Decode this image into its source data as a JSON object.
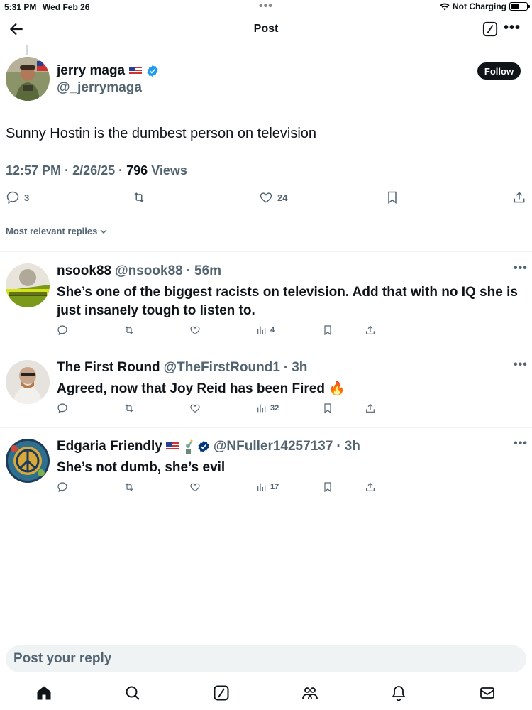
{
  "status": {
    "time": "5:31 PM",
    "date": "Wed Feb 26",
    "network": "Not Charging"
  },
  "header": {
    "title": "Post"
  },
  "post": {
    "author_name": "jerry maga",
    "author_handle": "@_jerrymaga",
    "follow_label": "Follow",
    "text": "Sunny Hostin is the dumbest person on television",
    "time": "12:57 PM",
    "date": "2/26/25",
    "views_count": "796",
    "views_label": "Views",
    "replies": "3",
    "likes": "24"
  },
  "sort_label": "Most relevant replies",
  "replies": [
    {
      "name": "nsook88",
      "handle": "@nsook88",
      "age": "56m",
      "text": "She’s one of the biggest racists on television. Add that with no IQ she is just insanely tough to listen to.",
      "views": "4"
    },
    {
      "name": "The First Round",
      "handle": "@TheFirstRound1",
      "age": "3h",
      "text": "Agreed, now that Joy Reid has been Fired 🔥",
      "views": "32"
    },
    {
      "name": "Edgaria Friendly",
      "handle": "@NFuller14257137",
      "age": "3h",
      "text": "She’s not dumb, she’s evil",
      "views": "17"
    }
  ],
  "composer": {
    "placeholder": "Post your reply"
  },
  "colors": {
    "verified": "#1d9bf0",
    "verified_gov": "#00377a",
    "text": "#0f1419",
    "secondary": "#536471"
  }
}
